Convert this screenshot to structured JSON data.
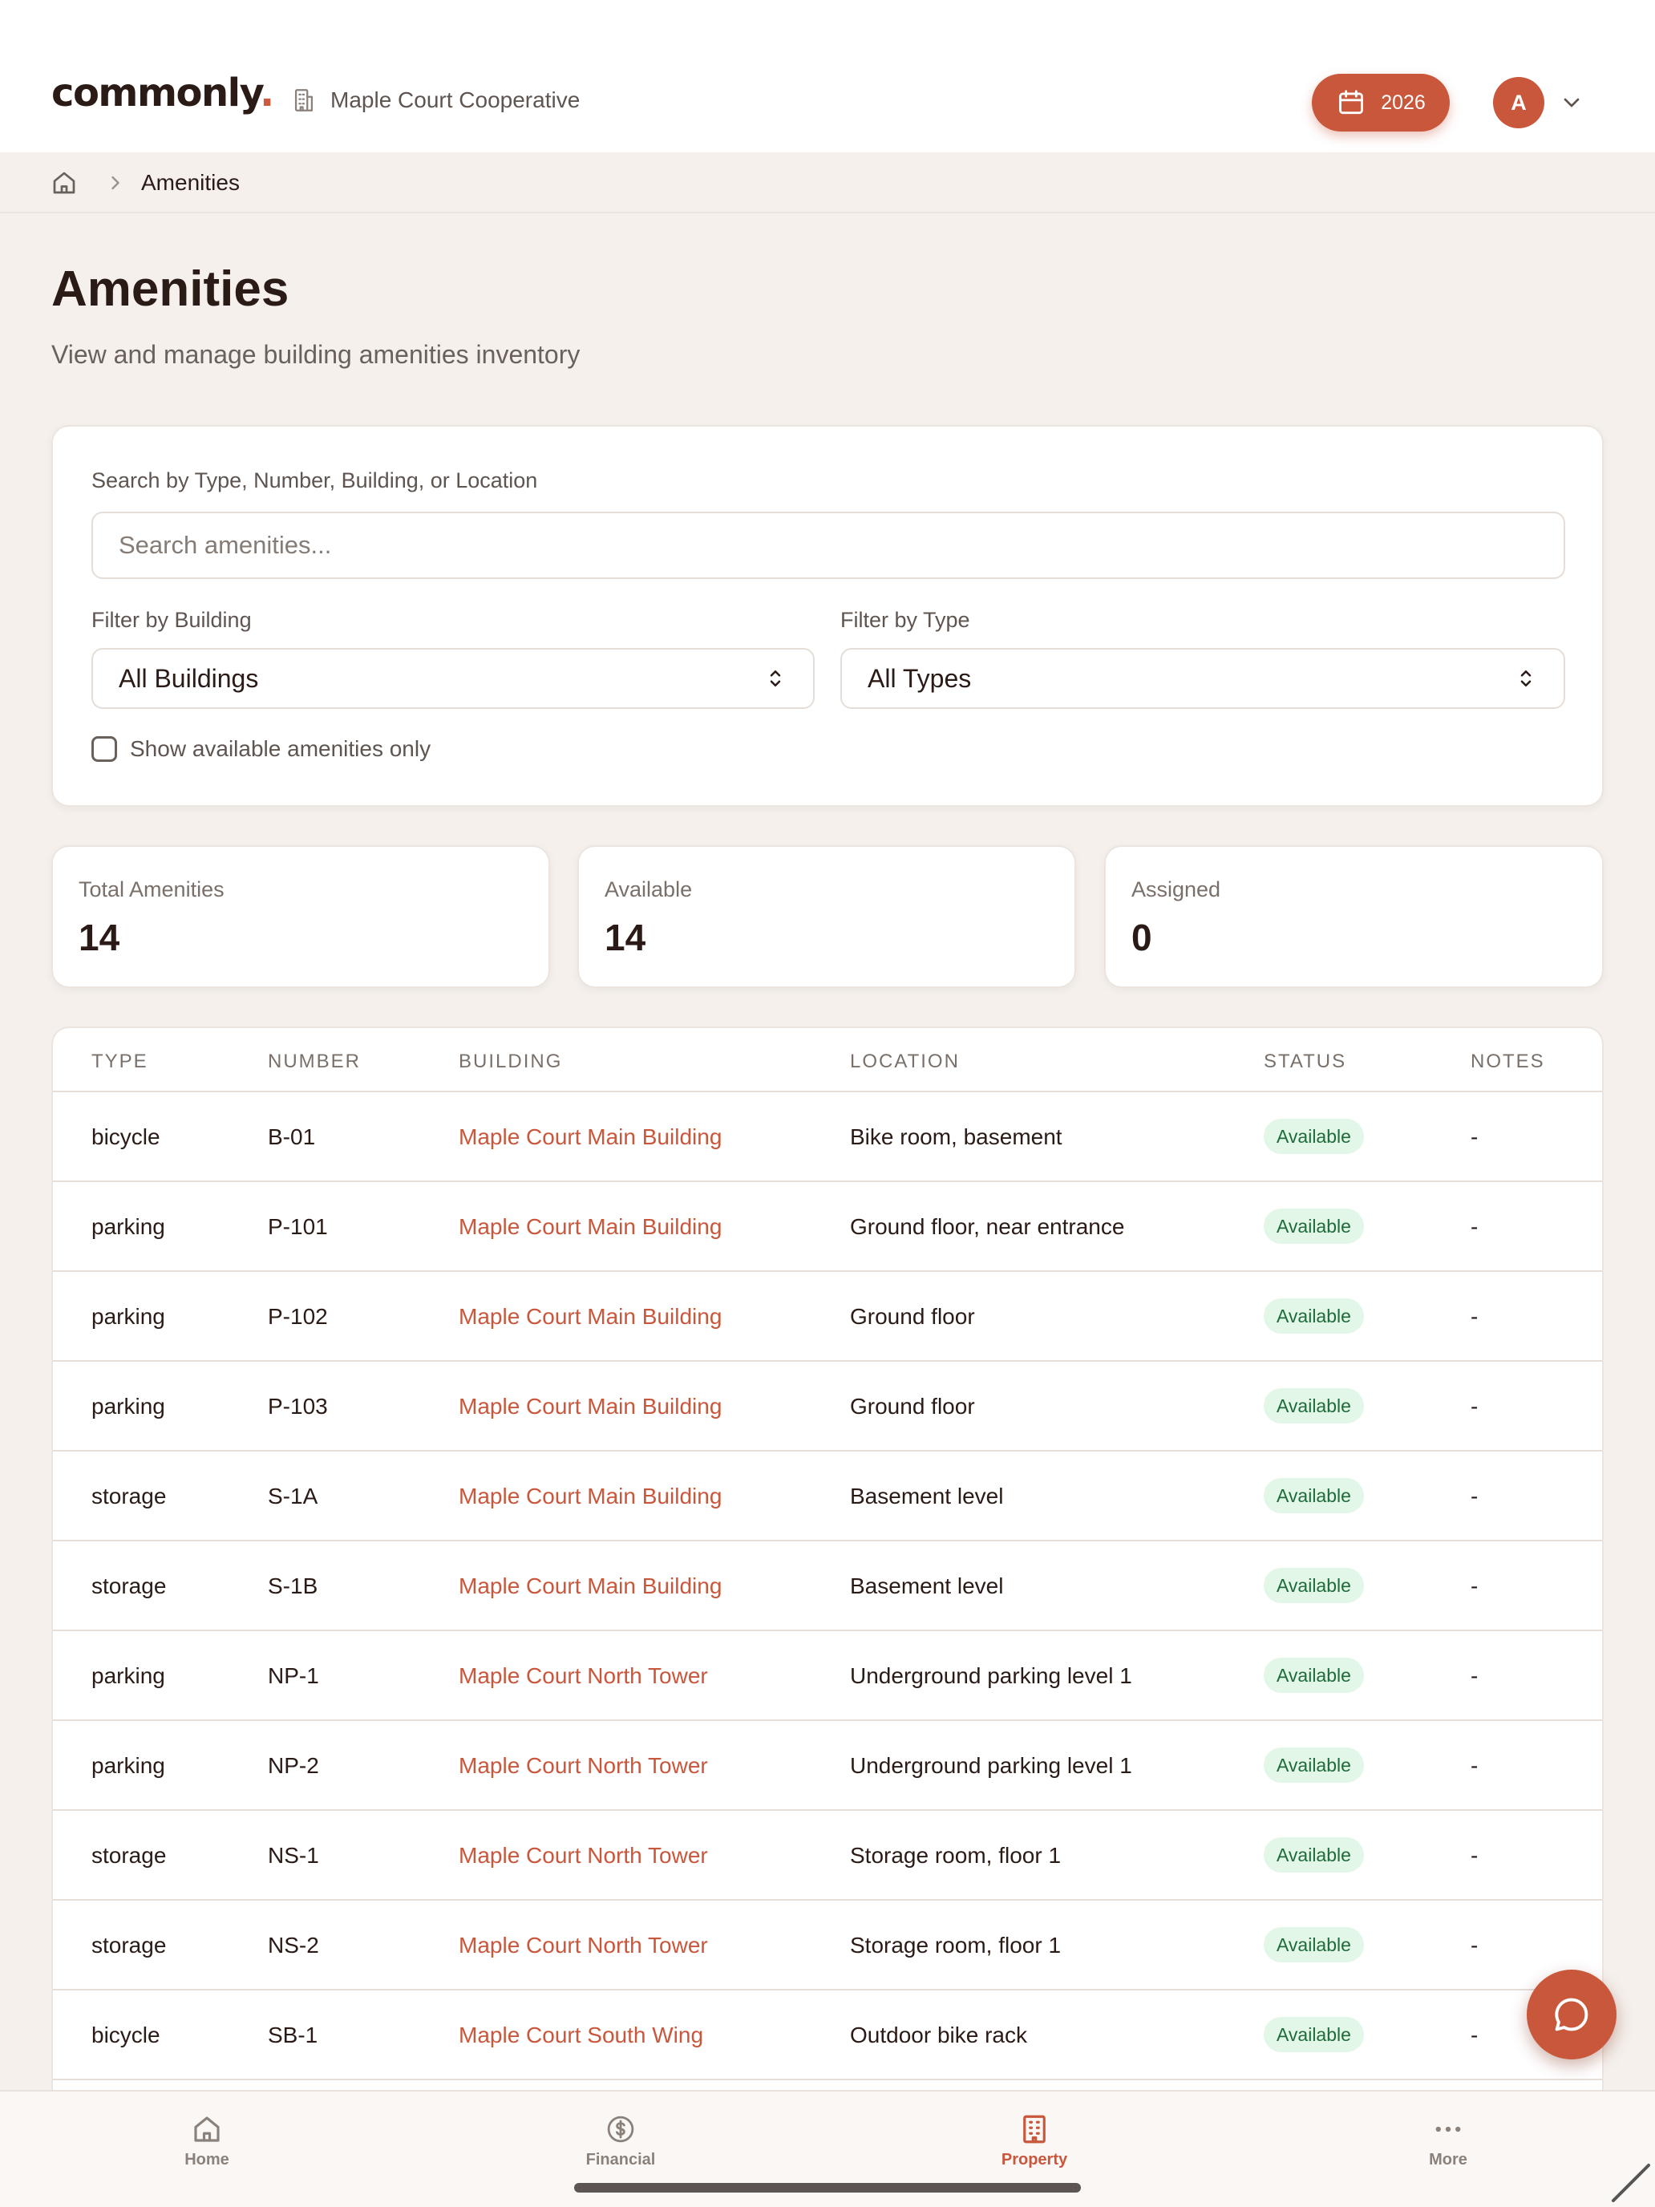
{
  "header": {
    "logo_text": "commonly",
    "logo_dot": ".",
    "org_name": "Maple Court Cooperative",
    "year_label": "2026",
    "avatar_initial": "A"
  },
  "breadcrumb": {
    "current": "Amenities"
  },
  "page": {
    "title": "Amenities",
    "subtitle": "View and manage building amenities inventory"
  },
  "filters": {
    "search_label": "Search by Type, Number, Building, or Location",
    "search_placeholder": "Search amenities...",
    "search_value": "",
    "building_label": "Filter by Building",
    "building_selected": "All Buildings",
    "type_label": "Filter by Type",
    "type_selected": "All Types",
    "available_only_label": "Show available amenities only"
  },
  "stats": [
    {
      "label": "Total Amenities",
      "value": "14"
    },
    {
      "label": "Available",
      "value": "14"
    },
    {
      "label": "Assigned",
      "value": "0"
    }
  ],
  "table": {
    "headers": [
      "Type",
      "Number",
      "Building",
      "Location",
      "Status",
      "Notes"
    ],
    "rows": [
      {
        "type": "bicycle",
        "number": "B-01",
        "building": "Maple Court Main Building",
        "location": "Bike room, basement",
        "status": "Available",
        "notes": "-"
      },
      {
        "type": "parking",
        "number": "P-101",
        "building": "Maple Court Main Building",
        "location": "Ground floor, near entrance",
        "status": "Available",
        "notes": "-"
      },
      {
        "type": "parking",
        "number": "P-102",
        "building": "Maple Court Main Building",
        "location": "Ground floor",
        "status": "Available",
        "notes": "-"
      },
      {
        "type": "parking",
        "number": "P-103",
        "building": "Maple Court Main Building",
        "location": "Ground floor",
        "status": "Available",
        "notes": "-"
      },
      {
        "type": "storage",
        "number": "S-1A",
        "building": "Maple Court Main Building",
        "location": "Basement level",
        "status": "Available",
        "notes": "-"
      },
      {
        "type": "storage",
        "number": "S-1B",
        "building": "Maple Court Main Building",
        "location": "Basement level",
        "status": "Available",
        "notes": "-"
      },
      {
        "type": "parking",
        "number": "NP-1",
        "building": "Maple Court North Tower",
        "location": "Underground parking level 1",
        "status": "Available",
        "notes": "-"
      },
      {
        "type": "parking",
        "number": "NP-2",
        "building": "Maple Court North Tower",
        "location": "Underground parking level 1",
        "status": "Available",
        "notes": "-"
      },
      {
        "type": "storage",
        "number": "NS-1",
        "building": "Maple Court North Tower",
        "location": "Storage room, floor 1",
        "status": "Available",
        "notes": "-"
      },
      {
        "type": "storage",
        "number": "NS-2",
        "building": "Maple Court North Tower",
        "location": "Storage room, floor 1",
        "status": "Available",
        "notes": "-"
      },
      {
        "type": "bicycle",
        "number": "SB-1",
        "building": "Maple Court South Wing",
        "location": "Outdoor bike rack",
        "status": "Available",
        "notes": "-"
      }
    ]
  },
  "bottom_nav": [
    {
      "label": "Home",
      "icon": "home-icon",
      "active": false
    },
    {
      "label": "Financial",
      "icon": "dollar-icon",
      "active": false
    },
    {
      "label": "Property",
      "icon": "building-icon",
      "active": true
    },
    {
      "label": "More",
      "icon": "more-icon",
      "active": false
    }
  ],
  "colors": {
    "accent": "#c9573c",
    "background": "#f5f0ec",
    "badge_bg": "#e2f7e7",
    "badge_text": "#1f6b3a"
  }
}
